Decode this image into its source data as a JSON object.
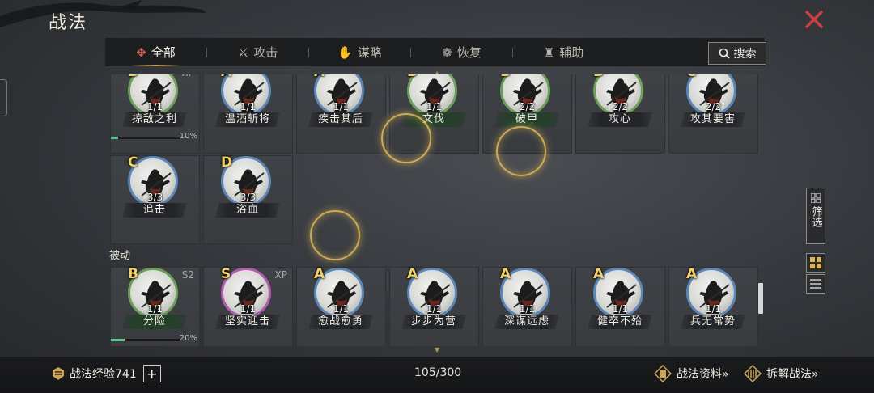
{
  "header": {
    "title": "战法"
  },
  "tabs": [
    {
      "label": "全部",
      "icon": "all-icon",
      "active": true
    },
    {
      "label": "攻击",
      "icon": "crossed-swords-icon",
      "active": false
    },
    {
      "label": "谋略",
      "icon": "scheme-icon",
      "active": false
    },
    {
      "label": "恢复",
      "icon": "recovery-icon",
      "active": false
    },
    {
      "label": "辅助",
      "icon": "support-icon",
      "active": false
    }
  ],
  "search": {
    "label": "搜索"
  },
  "active_cards": [
    {
      "grade": "B",
      "count": "1/1",
      "name": "掠敌之利",
      "tag": "XP",
      "progress": 0.1,
      "progress_label": "10%",
      "ring": "green",
      "name_style": "dark"
    },
    {
      "grade": "A",
      "count": "1/1",
      "name": "温酒斩将",
      "tag": "",
      "ring": "blue",
      "name_style": "dark"
    },
    {
      "grade": "A",
      "count": "1/1",
      "name": "疾击其后",
      "tag": "",
      "ring": "blue",
      "name_style": "dark"
    },
    {
      "grade": "B",
      "count": "1/1",
      "name": "文伐",
      "tag": "",
      "ring": "green",
      "name_style": "green"
    },
    {
      "grade": "B",
      "count": "2/2",
      "name": "破甲",
      "tag": "",
      "ring": "green",
      "name_style": "green"
    },
    {
      "grade": "B",
      "count": "2/2",
      "name": "攻心",
      "tag": "",
      "ring": "green",
      "name_style": "dark"
    },
    {
      "grade": "C",
      "count": "2/2",
      "name": "攻其要害",
      "tag": "",
      "ring": "blue",
      "name_style": "dark"
    },
    {
      "grade": "C",
      "count": "3/3",
      "name": "追击",
      "tag": "",
      "ring": "blue",
      "name_style": "dark"
    },
    {
      "grade": "D",
      "count": "3/3",
      "name": "浴血",
      "tag": "",
      "ring": "blue",
      "name_style": "dark"
    }
  ],
  "passive_section": {
    "label": "被动"
  },
  "passive_cards": [
    {
      "grade": "B",
      "count": "1/1",
      "name": "分险",
      "tag": "S2",
      "progress": 0.2,
      "progress_label": "20%",
      "ring": "green",
      "name_style": "green"
    },
    {
      "grade": "S",
      "count": "1/1",
      "name": "坚实迎击",
      "tag": "XP",
      "ring": "purple",
      "name_style": "dark"
    },
    {
      "grade": "A",
      "count": "1/1",
      "name": "愈战愈勇",
      "tag": "",
      "ring": "blue",
      "name_style": "dark"
    },
    {
      "grade": "A",
      "count": "1/1",
      "name": "步步为营",
      "tag": "",
      "ring": "blue",
      "name_style": "dark"
    },
    {
      "grade": "A",
      "count": "1/1",
      "name": "深谋远虑",
      "tag": "",
      "ring": "blue",
      "name_style": "dark"
    },
    {
      "grade": "A",
      "count": "1/1",
      "name": "健卒不殆",
      "tag": "",
      "ring": "blue",
      "name_style": "dark"
    },
    {
      "grade": "A",
      "count": "1/1",
      "name": "兵无常势",
      "tag": "",
      "ring": "blue",
      "name_style": "dark"
    }
  ],
  "side": {
    "filter_label": "筛选"
  },
  "footer": {
    "exp_label": "战法经验741",
    "plus_label": "+",
    "counter": "105/300",
    "info_link": "战法资料»",
    "disassemble_link": "拆解战法»"
  },
  "colors": {
    "accent_gold": "#c9a45a",
    "grade_yellow": "#f1d16a",
    "progress_green": "#5ec38a",
    "close_red": "#c94040"
  }
}
